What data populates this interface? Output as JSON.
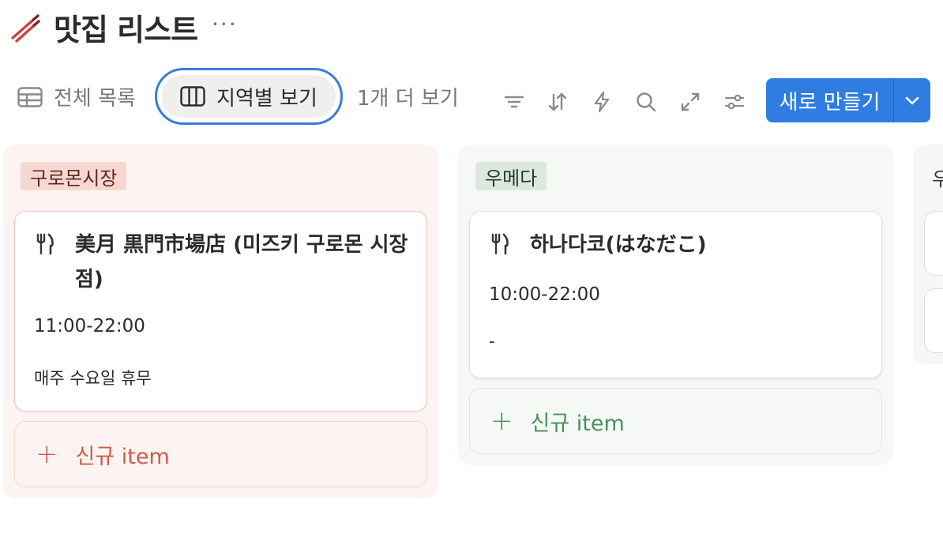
{
  "page": {
    "title": "맛집 리스트",
    "icon": "chopsticks-icon",
    "more_label": "···"
  },
  "views": {
    "all": {
      "label": "전체 목록",
      "icon": "table-icon"
    },
    "region": {
      "label": "지역별 보기",
      "icon": "board-icon",
      "active": true
    },
    "more": "1개 더 보기"
  },
  "toolbar": {
    "icons": [
      "filter-icon",
      "sort-icon",
      "automation-icon",
      "search-icon",
      "expand-icon",
      "settings-icon"
    ],
    "new_button": "새로 만들기",
    "accent_color": "#2f7de0"
  },
  "board": {
    "columns": [
      {
        "name": "구로몬시장",
        "color": "#f8d7d3",
        "cards": [
          {
            "title": "美月 黒門市場店 (미즈키 구로몬 시장점)",
            "hours": "11:00-22:00",
            "note": "매주 수요일 휴무"
          }
        ],
        "add_label": "신규 item"
      },
      {
        "name": "우메다",
        "color": "#dbe8dc",
        "cards": [
          {
            "title": "하나다코(はなだこ)",
            "hours": "10:00-22:00",
            "note": "-"
          }
        ],
        "add_label": "신규 item"
      },
      {
        "name": "우"
      }
    ]
  }
}
